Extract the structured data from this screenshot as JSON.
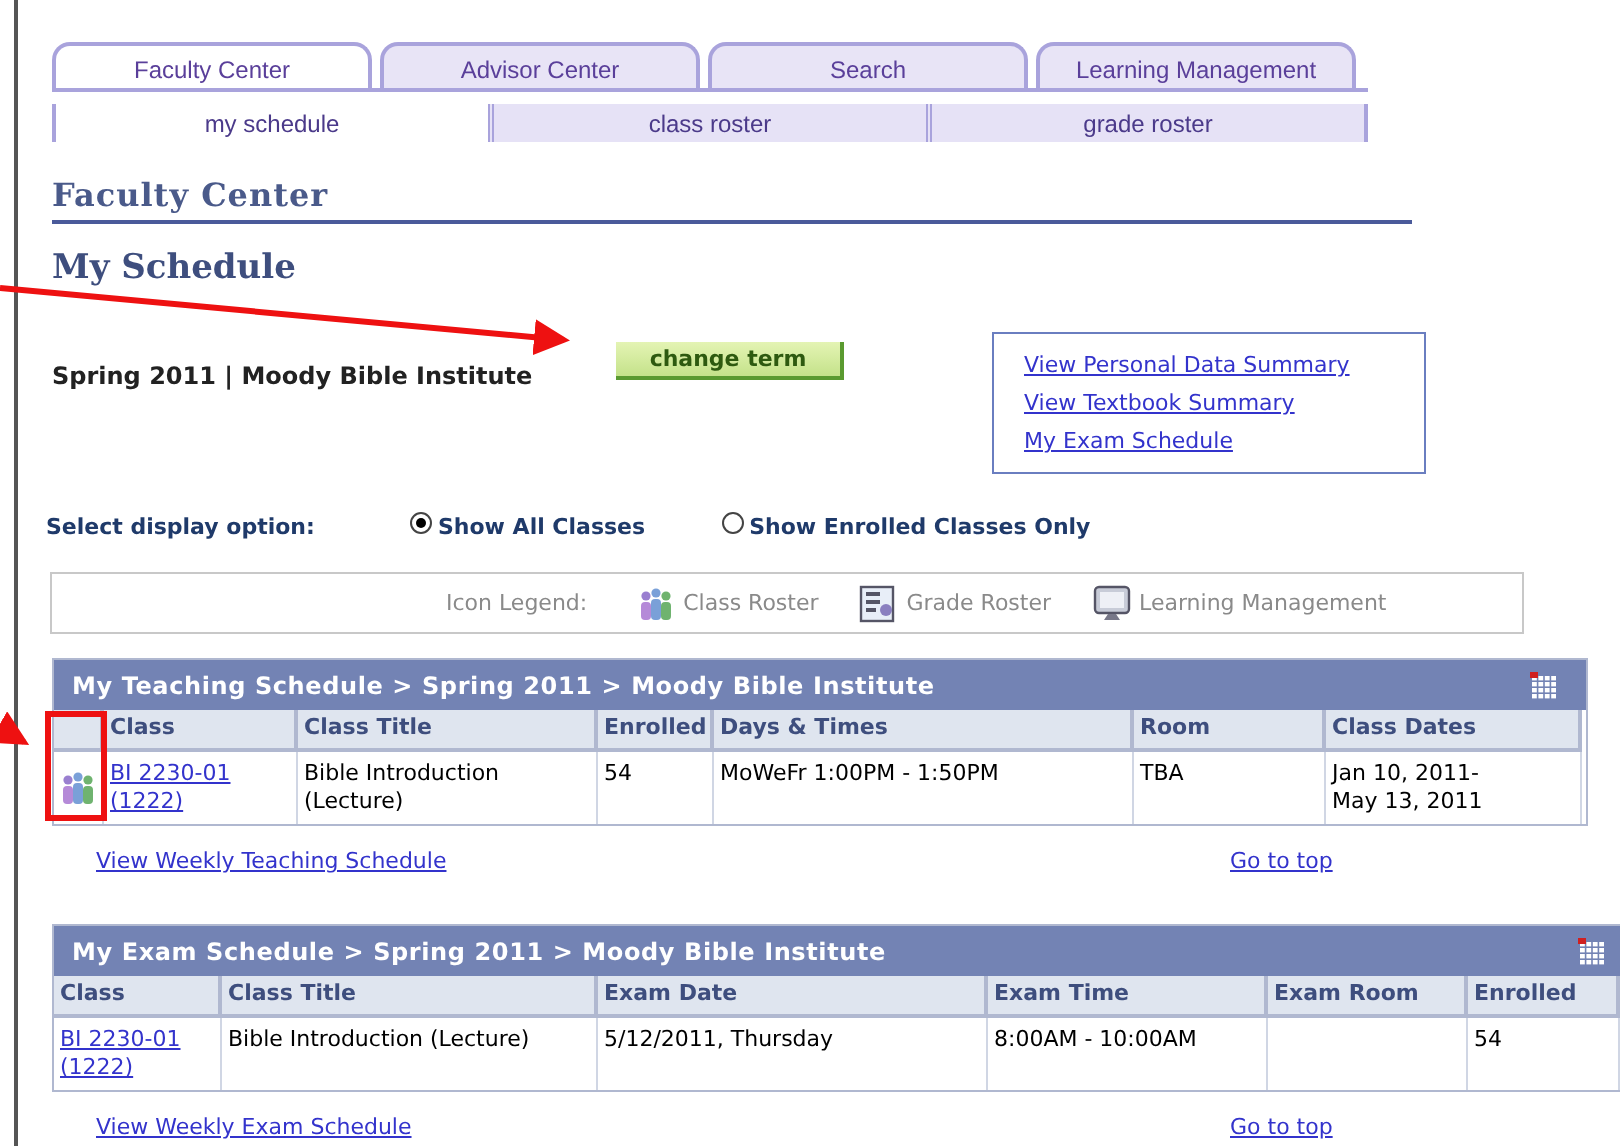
{
  "main_tabs": [
    {
      "label": "Faculty Center",
      "selected": true
    },
    {
      "label": "Advisor Center",
      "selected": false
    },
    {
      "label": "Search",
      "selected": false
    },
    {
      "label": "Learning Management",
      "selected": false
    }
  ],
  "sub_tabs": [
    {
      "label": "my schedule",
      "selected": true
    },
    {
      "label": "class roster",
      "selected": false
    },
    {
      "label": "grade roster",
      "selected": false
    }
  ],
  "page_header": "Faculty Center",
  "page_title": "My Schedule",
  "term": "Spring 2011 | Moody Bible Institute",
  "change_term_button": "change term",
  "links": [
    "View Personal Data Summary",
    "View Textbook Summary",
    "My Exam Schedule"
  ],
  "display_option": {
    "label": "Select display option:",
    "options": [
      {
        "label": "Show All Classes",
        "selected": true
      },
      {
        "label": "Show Enrolled Classes Only",
        "selected": false
      }
    ]
  },
  "icon_legend": {
    "label": "Icon Legend:",
    "items": [
      {
        "kind": "class_roster",
        "label": "Class Roster"
      },
      {
        "kind": "grade_roster",
        "label": "Grade Roster"
      },
      {
        "kind": "learning_management",
        "label": "Learning Management"
      }
    ]
  },
  "teaching_schedule": {
    "title": "My Teaching Schedule > Spring 2011 > Moody Bible Institute",
    "columns": [
      "Class",
      "Class Title",
      "Enrolled",
      "Days & Times",
      "Room",
      "Class Dates"
    ],
    "rows": [
      [
        "BI 2230-01\n(1222)",
        "Bible Introduction\n(Lecture)",
        "54",
        "MoWeFr 1:00PM - 1:50PM",
        "TBA",
        "Jan 10, 2011-\nMay 13, 2011"
      ]
    ],
    "footer_link": "View Weekly Teaching Schedule",
    "top_link": "Go to top"
  },
  "exam_schedule": {
    "title": "My Exam Schedule > Spring 2011 > Moody Bible Institute",
    "columns": [
      "Class",
      "Class Title",
      "Exam Date",
      "Exam Time",
      "Exam Room",
      "Enrolled"
    ],
    "rows": [
      [
        "BI 2230-01\n(1222)",
        "Bible Introduction (Lecture)",
        "5/12/2011, Thursday",
        "8:00AM - 10:00AM",
        "",
        "54"
      ]
    ],
    "footer_link": "View Weekly Exam Schedule",
    "top_link": "Go to top"
  }
}
